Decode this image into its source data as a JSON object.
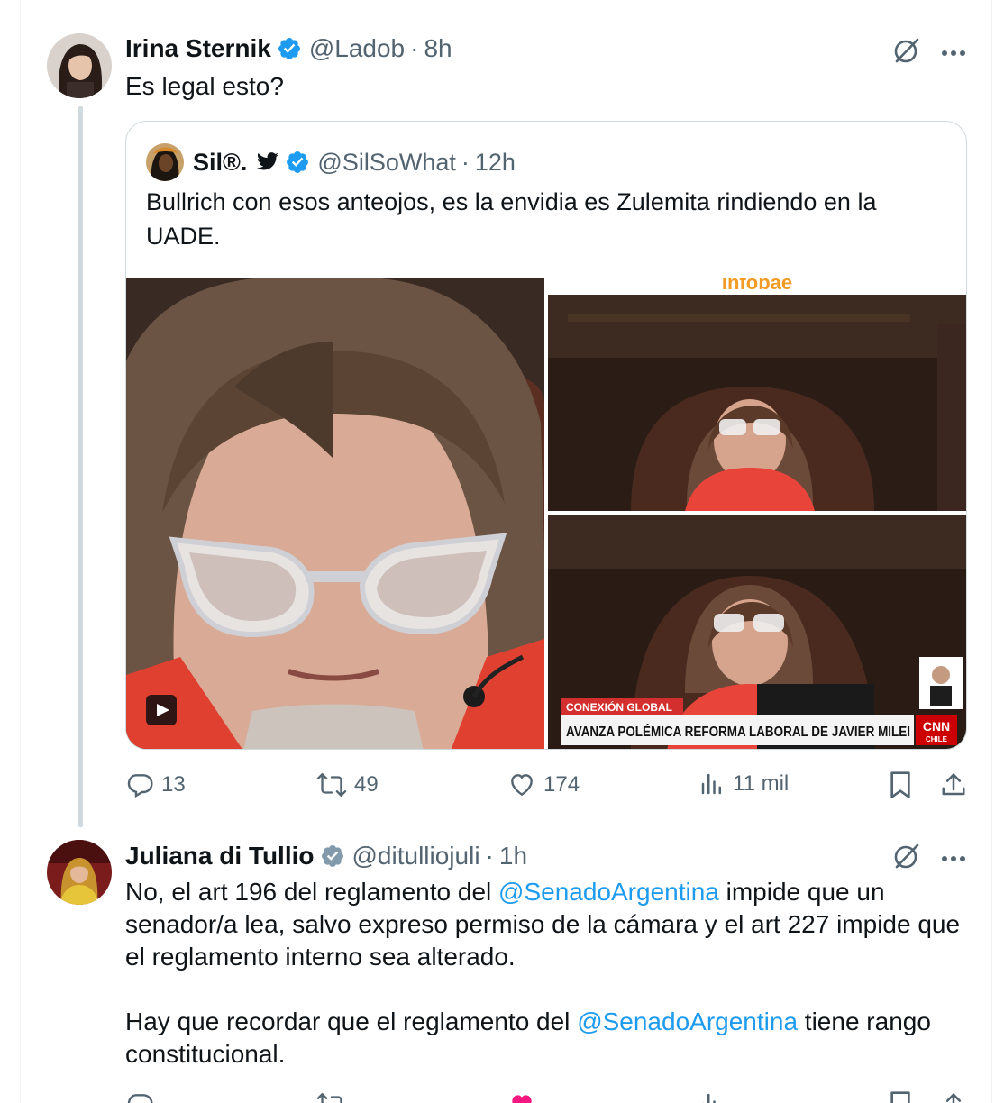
{
  "tweet1": {
    "author_name": "Irina Sternik",
    "handle": "@Ladob",
    "separator": "·",
    "time": "8h",
    "text": "Es  legal esto?"
  },
  "quote": {
    "author_name": "Sil®.",
    "handle": "@SilSoWhat",
    "separator": "·",
    "time": "12h",
    "text": "Bullrich con esos anteojos, es la envidia es Zulemita rindiendo en la UADE.",
    "media_caption_small": "CONEXIÓN GLOBAL",
    "media_caption_main": "AVANZA POLÉMICA REFORMA LABORAL DE JAVIER MILEI",
    "media_brand": "CNN",
    "media_brand_sub": "CHILE",
    "media_top_text": "Infobae"
  },
  "tweet1_actions": {
    "replies": "13",
    "reposts": "49",
    "likes": "174",
    "views": "11 mil"
  },
  "tweet2": {
    "author_name": "Juliana di Tullio",
    "handle": "@ditulliojuli",
    "separator": "·",
    "time": "1h",
    "p1_a": "No, el art 196 del reglamento del ",
    "p1_mention": "@SenadoArgentina",
    "p1_b": " impide que un senador/a lea, salvo expreso permiso de la cámara y el art 227 impide que el reglamento interno sea alterado.",
    "p2_a": "Hay que recordar que el reglamento del ",
    "p2_mention": "@SenadoArgentina",
    "p2_b": " tiene rango constitucional."
  },
  "colors": {
    "accent": "#1d9bf0",
    "verified_blue": "#1d9bf0",
    "verified_gray": "#829aab",
    "muted": "#536471",
    "like_pink": "#f91880"
  }
}
